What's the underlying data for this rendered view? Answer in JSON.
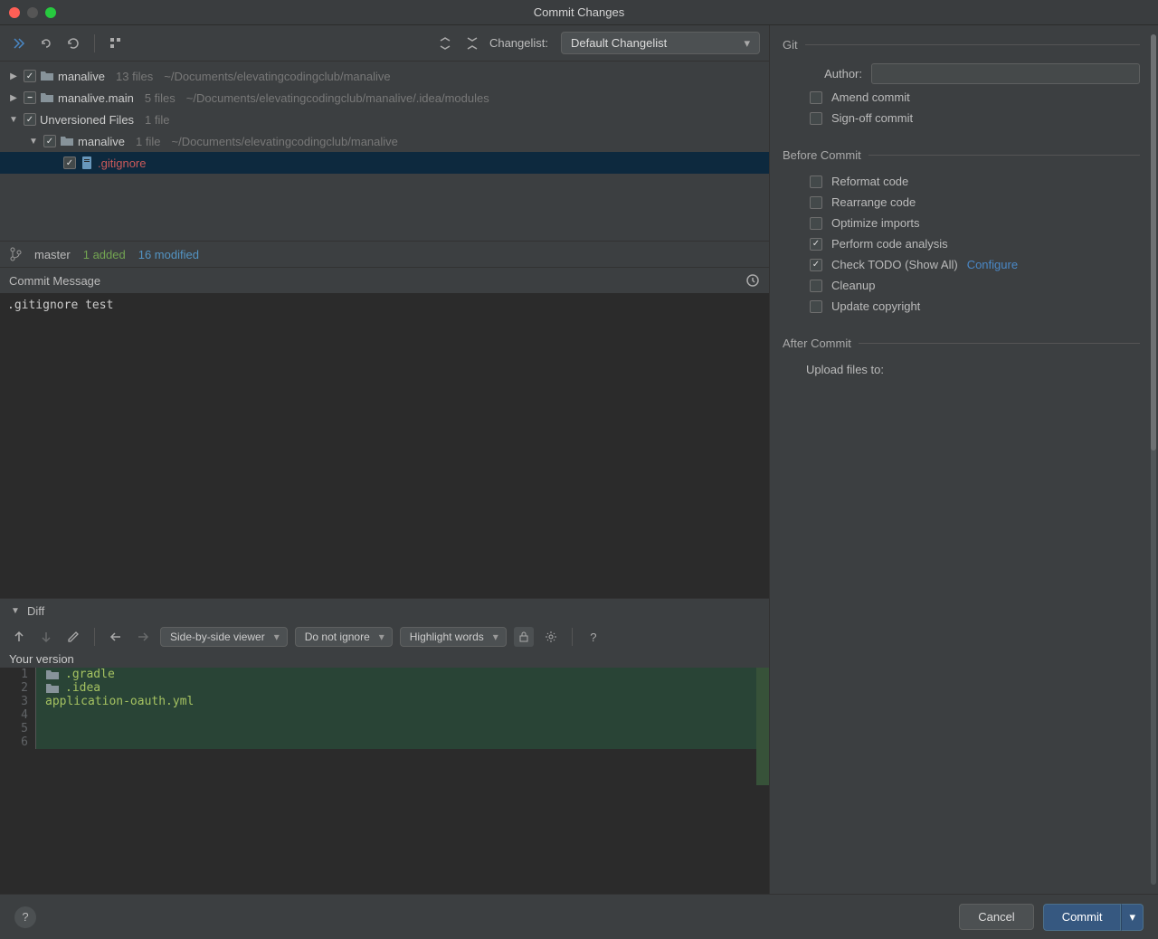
{
  "title": "Commit Changes",
  "toolbar": {
    "changelist_label": "Changelist:",
    "changelist_value": "Default Changelist"
  },
  "tree": [
    {
      "indent": 0,
      "expander": "▶",
      "check": "checked",
      "icon": "folder",
      "label": "manalive",
      "meta1": "13 files",
      "meta2": "~/Documents/elevatingcodingclub/manalive"
    },
    {
      "indent": 0,
      "expander": "▶",
      "check": "indet",
      "icon": "folder",
      "label": "manalive.main",
      "meta1": "5 files",
      "meta2": "~/Documents/elevatingcodingclub/manalive/.idea/modules"
    },
    {
      "indent": 0,
      "expander": "▼",
      "check": "checked",
      "icon": "none",
      "label": "Unversioned Files",
      "meta1": "1 file",
      "meta2": ""
    },
    {
      "indent": 1,
      "expander": "▼",
      "check": "checked",
      "icon": "folder",
      "label": "manalive",
      "meta1": "1 file",
      "meta2": "~/Documents/elevatingcodingclub/manalive"
    },
    {
      "indent": 2,
      "expander": "",
      "check": "checked",
      "icon": "file",
      "label": ".gitignore",
      "meta1": "",
      "meta2": "",
      "new": true,
      "highlight": true
    }
  ],
  "status": {
    "branch": "master",
    "added": "1 added",
    "modified": "16 modified"
  },
  "commit_message_label": "Commit Message",
  "commit_message": ".gitignore test",
  "diff": {
    "header": "Diff",
    "viewer": "Side-by-side viewer",
    "ignore": "Do not ignore",
    "highlight": "Highlight words",
    "your_version": "Your version",
    "lines": [
      {
        "n": "1",
        "icon": true,
        "text": ".gradle"
      },
      {
        "n": "2",
        "icon": true,
        "text": ".idea"
      },
      {
        "n": "3",
        "icon": false,
        "text": "application-oauth.yml"
      },
      {
        "n": "4",
        "icon": false,
        "text": ""
      },
      {
        "n": "5",
        "icon": false,
        "text": ""
      },
      {
        "n": "6",
        "icon": false,
        "text": ""
      }
    ]
  },
  "git_panel": {
    "title": "Git",
    "author_label": "Author:",
    "author_value": "",
    "amend": "Amend commit",
    "signoff": "Sign-off commit",
    "before_title": "Before Commit",
    "reformat": "Reformat code",
    "rearrange": "Rearrange code",
    "optimize": "Optimize imports",
    "analysis": "Perform code analysis",
    "todo": "Check TODO (Show All)",
    "configure": "Configure",
    "cleanup": "Cleanup",
    "copyright": "Update copyright",
    "after_title": "After Commit",
    "upload": "Upload files to:"
  },
  "footer": {
    "cancel": "Cancel",
    "commit": "Commit"
  }
}
